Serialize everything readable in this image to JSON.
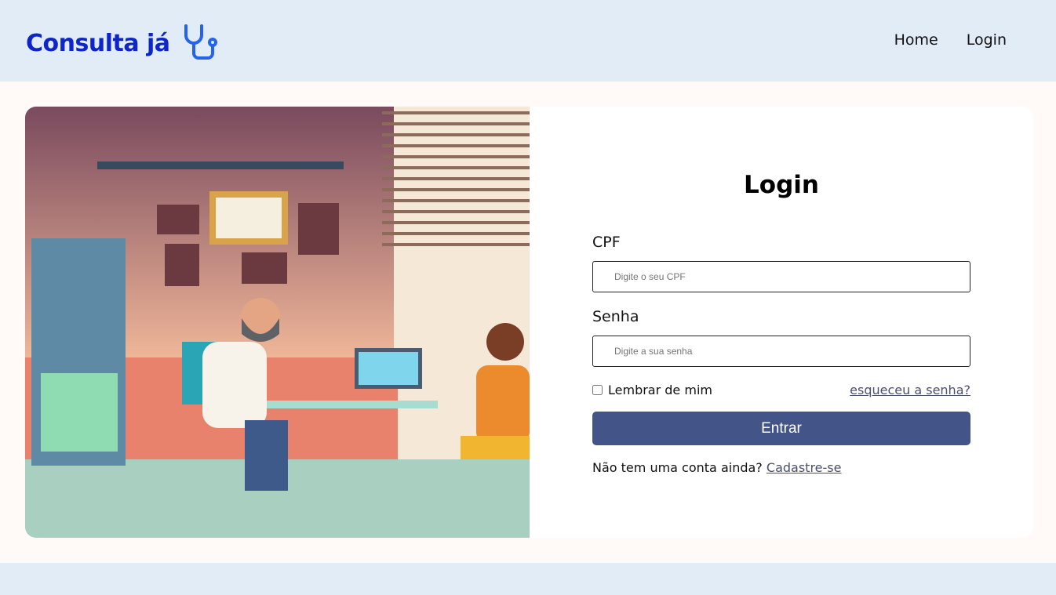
{
  "header": {
    "logo_text": "Consulta já",
    "logo_icon": "stethoscope-icon",
    "nav": [
      "Home",
      "Login"
    ]
  },
  "login": {
    "title": "Login",
    "cpf_label": "CPF",
    "cpf_placeholder": "Digite o seu CPF",
    "senha_label": "Senha",
    "senha_placeholder": "Digite a sua senha",
    "remember": "Lembrar de mim",
    "forgot": "esqueceu a senha?",
    "submit": "Entrar",
    "signup_prompt": "Não tem uma conta ainda?",
    "signup_link": "Cadastre-se"
  },
  "colors": {
    "brand": "#0e25c9",
    "button": "#435488",
    "header_bg": "#e2ecf7"
  }
}
